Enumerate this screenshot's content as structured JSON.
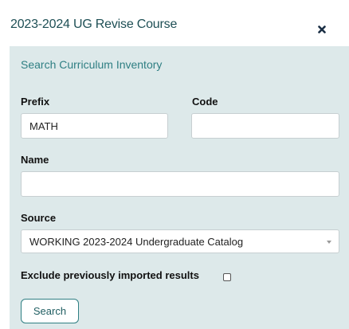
{
  "dialog": {
    "title": "2023-2024 UG Revise Course",
    "close_icon": "close-icon"
  },
  "search_panel": {
    "heading": "Search Curriculum Inventory",
    "prefix": {
      "label": "Prefix",
      "value": "MATH"
    },
    "code": {
      "label": "Code",
      "value": ""
    },
    "name": {
      "label": "Name",
      "value": ""
    },
    "source": {
      "label": "Source",
      "selected": "WORKING 2023-2024 Undergraduate Catalog",
      "caret_icon": "chevron-down-icon"
    },
    "exclude_imported": {
      "label": "Exclude previously imported results",
      "checked": false
    },
    "search_button_label": "Search"
  },
  "colors": {
    "title_text": "#1e4f55",
    "panel_background": "#dde9ea",
    "heading_text": "#2f7f83",
    "button_border": "#2f7f83"
  }
}
